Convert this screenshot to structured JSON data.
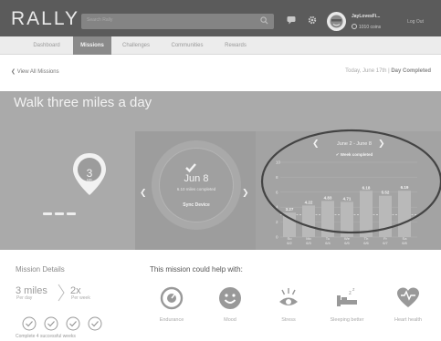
{
  "header": {
    "logo": "RALLY",
    "search_placeholder": "Search Rally",
    "user_name": "JayLovesFi...",
    "coins": "1010 coins",
    "logout": "Log Out",
    "icons": [
      "search-icon",
      "chat-icon",
      "gear-icon",
      "avatar"
    ]
  },
  "nav": {
    "tabs": [
      {
        "label": "Dashboard",
        "active": false
      },
      {
        "label": "Missions",
        "active": true
      },
      {
        "label": "Challenges",
        "active": false
      },
      {
        "label": "Communities",
        "active": false
      },
      {
        "label": "Rewards",
        "active": false
      }
    ]
  },
  "subheader": {
    "back_label": "View All Missions",
    "today_prefix": "Today, June 17th | ",
    "today_status": "Day Completed"
  },
  "mission": {
    "title": "Walk three miles a day",
    "goal_value": "3",
    "goal_unit": "MI",
    "day": {
      "date": "Jun 8",
      "miles_completed": "6.10 miles completed",
      "sync_label": "Sync Device"
    },
    "week": {
      "range": "June 2 - June 8",
      "status": "Week completed"
    }
  },
  "chart_data": {
    "type": "bar",
    "title": "",
    "categories": [
      "Su 6/2",
      "Mo 6/3",
      "Tu 6/4",
      "We 6/5",
      "Th 6/6",
      "Fr 6/7",
      "Sa 6/8"
    ],
    "values": [
      3.27,
      4.22,
      4.83,
      4.71,
      6.18,
      5.52,
      6.19
    ],
    "value_labels": [
      "3.27",
      "4.22",
      "4.83",
      "4.71",
      "6.18",
      "5.52",
      "6.19"
    ],
    "ylim": [
      0,
      10
    ],
    "y_ticks": [
      "10",
      "8",
      "6",
      "4",
      "2",
      "0"
    ],
    "goal_line": 3,
    "xlabel": "",
    "ylabel": ""
  },
  "details": {
    "title": "Mission Details",
    "per_day_value": "3 miles",
    "per_day_label": "Per day",
    "per_week_value": "2x",
    "per_week_label": "Per week",
    "checks": 4,
    "complete_label": "Complete 4 successful weeks"
  },
  "help": {
    "title": "This mission could help with:",
    "benefits": [
      {
        "label": "Endurance",
        "icon": "endurance-icon"
      },
      {
        "label": "Mood",
        "icon": "mood-icon"
      },
      {
        "label": "Stress",
        "icon": "stress-icon"
      },
      {
        "label": "Sleeping better",
        "icon": "sleep-icon"
      },
      {
        "label": "Heart health",
        "icon": "heart-icon"
      }
    ]
  },
  "colors": {
    "header_bg": "#5b5b5b",
    "hero_bg": "#aaaaaa",
    "active_tab": "#8a8a8a",
    "bar": "#b9b9b9",
    "annotation_circle": "#444444"
  }
}
